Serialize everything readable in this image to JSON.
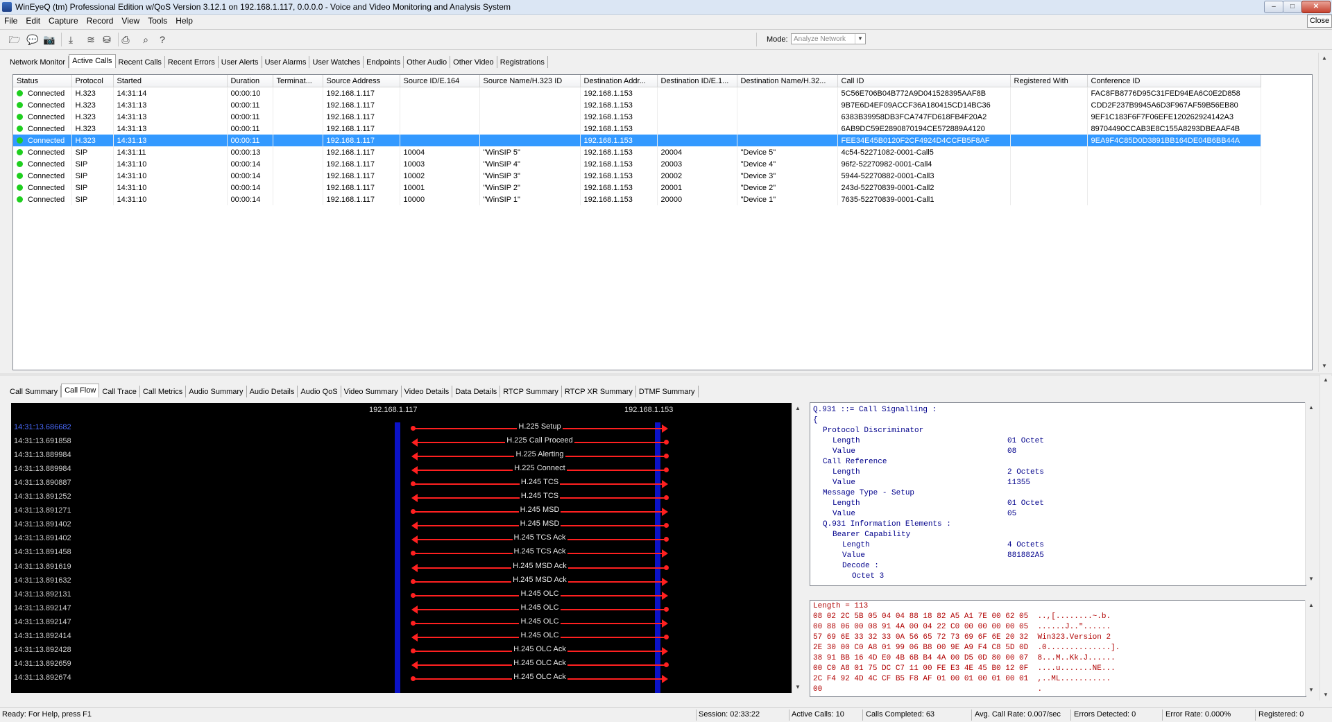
{
  "window": {
    "title": "WinEyeQ (tm) Professional Edition w/QoS Version 3.12.1 on 192.168.1.117, 0.0.0.0 - Voice and Video Monitoring and Analysis System",
    "close_label": "Close"
  },
  "menu": [
    "File",
    "Edit",
    "Capture",
    "Record",
    "View",
    "Tools",
    "Help"
  ],
  "toolbar": {
    "icons": [
      "open-icon",
      "chat-icon",
      "camera-icon",
      "download-icon",
      "layers-icon",
      "traffic-light-icon",
      "print-icon",
      "search-icon",
      "help-icon"
    ],
    "mode_label": "Mode:",
    "mode_value": "Analyze Network"
  },
  "top_tabs": [
    "Network Monitor",
    "Active Calls",
    "Recent Calls",
    "Recent Errors",
    "User Alerts",
    "User Alarms",
    "User Watches",
    "Endpoints",
    "Other Audio",
    "Other Video",
    "Registrations"
  ],
  "top_tab_active": 1,
  "calls": {
    "columns": [
      "Status",
      "Protocol",
      "Started",
      "Duration",
      "Terminat...",
      "Source Address",
      "Source ID/E.164",
      "Source Name/H.323 ID",
      "Destination Addr...",
      "Destination ID/E.1...",
      "Destination Name/H.32...",
      "Call ID",
      "Registered With",
      "Conference ID"
    ],
    "status_color": "#1fcf1f",
    "selected_row": 4,
    "rows": [
      [
        "Connected",
        "H.323",
        "14:31:14",
        "00:00:10",
        "",
        "192.168.1.117",
        "",
        "",
        "192.168.1.153",
        "",
        "",
        "5C56E706B04B772A9D041528395AAF8B",
        "",
        "FAC8FB8776D95C31FED94EA6C0E2D858"
      ],
      [
        "Connected",
        "H.323",
        "14:31:13",
        "00:00:11",
        "",
        "192.168.1.117",
        "",
        "",
        "192.168.1.153",
        "",
        "",
        "9B7E6D4EF09ACCF36A180415CD14BC36",
        "",
        "CDD2F237B9945A6D3F967AF59B56EB80"
      ],
      [
        "Connected",
        "H.323",
        "14:31:13",
        "00:00:11",
        "",
        "192.168.1.117",
        "",
        "",
        "192.168.1.153",
        "",
        "",
        "6383B39958DB3FCA747FD618FB4F20A2",
        "",
        "9EF1C183F6F7F06EFE120262924142A3"
      ],
      [
        "Connected",
        "H.323",
        "14:31:13",
        "00:00:11",
        "",
        "192.168.1.117",
        "",
        "",
        "192.168.1.153",
        "",
        "",
        "6AB9DC59E2890870194CE572889A4120",
        "",
        "89704490CCAB3E8C155A8293DBEAAF4B"
      ],
      [
        "Connected",
        "H.323",
        "14:31:13",
        "00:00:11",
        "",
        "192.168.1.117",
        "",
        "",
        "192.168.1.153",
        "",
        "",
        "FEE34E45B0120F2CF4924D4CCFB5F8AF",
        "",
        "9EA9F4C85D0D3891BB164DE04B6BB44A"
      ],
      [
        "Connected",
        "SIP",
        "14:31:11",
        "00:00:13",
        "",
        "192.168.1.117",
        "10004",
        "\"WinSIP 5\"",
        "192.168.1.153",
        "20004",
        "\"Device 5\"",
        "4c54-52271082-0001-Call5",
        "",
        ""
      ],
      [
        "Connected",
        "SIP",
        "14:31:10",
        "00:00:14",
        "",
        "192.168.1.117",
        "10003",
        "\"WinSIP 4\"",
        "192.168.1.153",
        "20003",
        "\"Device 4\"",
        "96f2-52270982-0001-Call4",
        "",
        ""
      ],
      [
        "Connected",
        "SIP",
        "14:31:10",
        "00:00:14",
        "",
        "192.168.1.117",
        "10002",
        "\"WinSIP 3\"",
        "192.168.1.153",
        "20002",
        "\"Device 3\"",
        "5944-52270882-0001-Call3",
        "",
        ""
      ],
      [
        "Connected",
        "SIP",
        "14:31:10",
        "00:00:14",
        "",
        "192.168.1.117",
        "10001",
        "\"WinSIP 2\"",
        "192.168.1.153",
        "20001",
        "\"Device 2\"",
        "243d-52270839-0001-Call2",
        "",
        ""
      ],
      [
        "Connected",
        "SIP",
        "14:31:10",
        "00:00:14",
        "",
        "192.168.1.117",
        "10000",
        "\"WinSIP 1\"",
        "192.168.1.153",
        "20000",
        "\"Device 1\"",
        "7635-52270839-0001-Call1",
        "",
        ""
      ]
    ]
  },
  "bottom_tabs": [
    "Call Summary",
    "Call Flow",
    "Call Trace",
    "Call Metrics",
    "Audio Summary",
    "Audio Details",
    "Audio QoS",
    "Video Summary",
    "Video Details",
    "Data Details",
    "RTCP Summary",
    "RTCP XR Summary",
    "DTMF Summary"
  ],
  "bottom_tab_active": 1,
  "call_flow": {
    "left_host": "192.168.1.117",
    "right_host": "192.168.1.153",
    "messages": [
      {
        "time": "14:31:13.686682",
        "label": "H.225 Setup",
        "dir": "right"
      },
      {
        "time": "14:31:13.691858",
        "label": "H.225 Call Proceed",
        "dir": "left"
      },
      {
        "time": "14:31:13.889984",
        "label": "H.225 Alerting",
        "dir": "left"
      },
      {
        "time": "14:31:13.889984",
        "label": "H.225 Connect",
        "dir": "left"
      },
      {
        "time": "14:31:13.890887",
        "label": "H.245 TCS",
        "dir": "right"
      },
      {
        "time": "14:31:13.891252",
        "label": "H.245 TCS",
        "dir": "left"
      },
      {
        "time": "14:31:13.891271",
        "label": "H.245 MSD",
        "dir": "right"
      },
      {
        "time": "14:31:13.891402",
        "label": "H.245 MSD",
        "dir": "left"
      },
      {
        "time": "14:31:13.891402",
        "label": "H.245 TCS Ack",
        "dir": "left"
      },
      {
        "time": "14:31:13.891458",
        "label": "H.245 TCS Ack",
        "dir": "right"
      },
      {
        "time": "14:31:13.891619",
        "label": "H.245 MSD Ack",
        "dir": "left"
      },
      {
        "time": "14:31:13.891632",
        "label": "H.245 MSD Ack",
        "dir": "right"
      },
      {
        "time": "14:31:13.892131",
        "label": "H.245 OLC",
        "dir": "right"
      },
      {
        "time": "14:31:13.892147",
        "label": "H.245 OLC",
        "dir": "left"
      },
      {
        "time": "14:31:13.892147",
        "label": "H.245 OLC",
        "dir": "right"
      },
      {
        "time": "14:31:13.892414",
        "label": "H.245 OLC",
        "dir": "left"
      },
      {
        "time": "14:31:13.892428",
        "label": "H.245 OLC Ack",
        "dir": "right"
      },
      {
        "time": "14:31:13.892659",
        "label": "H.245 OLC Ack",
        "dir": "left"
      },
      {
        "time": "14:31:13.892674",
        "label": "H.245 OLC Ack",
        "dir": "right"
      }
    ]
  },
  "decode": {
    "lines": [
      {
        "indent": 0,
        "name": "Q.931 ::= Call Signalling :",
        "value": ""
      },
      {
        "indent": 0,
        "name": "{",
        "value": ""
      },
      {
        "indent": 1,
        "name": "Protocol Discriminator",
        "value": ""
      },
      {
        "indent": 2,
        "name": "Length",
        "value": "01 Octet"
      },
      {
        "indent": 2,
        "name": "Value",
        "value": "08"
      },
      {
        "indent": 1,
        "name": "Call Reference",
        "value": ""
      },
      {
        "indent": 2,
        "name": "Length",
        "value": "2 Octets"
      },
      {
        "indent": 2,
        "name": "Value",
        "value": "11355"
      },
      {
        "indent": 1,
        "name": "Message Type - Setup",
        "value": ""
      },
      {
        "indent": 2,
        "name": "Length",
        "value": "01 Octet"
      },
      {
        "indent": 2,
        "name": "Value",
        "value": "05"
      },
      {
        "indent": 1,
        "name": "Q.931 Information Elements :",
        "value": ""
      },
      {
        "indent": 2,
        "name": "Bearer Capability",
        "value": ""
      },
      {
        "indent": 3,
        "name": "Length",
        "value": "4 Octets"
      },
      {
        "indent": 3,
        "name": "Value",
        "value": "881882A5"
      },
      {
        "indent": 3,
        "name": "Decode :",
        "value": ""
      },
      {
        "indent": 4,
        "name": "Octet 3",
        "value": ""
      }
    ]
  },
  "hex": {
    "header": "Length = 113",
    "lines": [
      "08 02 2C 5B 05 04 04 88 18 82 A5 A1 7E 00 62 05  ..,[........~.b.",
      "00 88 06 00 08 91 4A 00 04 22 C0 00 00 00 00 05  ......J..\"......",
      "57 69 6E 33 32 33 0A 56 65 72 73 69 6F 6E 20 32  Win323.Version 2",
      "2E 30 00 C0 A8 01 99 06 B8 00 9E A9 F4 C8 5D 0D  .0..............].",
      "38 91 BB 16 4D E0 4B 6B B4 4A 00 D5 0D 80 00 07  8...M..Kk.J......",
      "00 C0 A8 01 75 DC C7 11 00 FE E3 4E 45 B0 12 0F  ....u.......NE...",
      "2C F4 92 4D 4C CF B5 F8 AF 01 00 01 00 01 00 01  ,..ML...........",
      "00                                               ."
    ]
  },
  "status": {
    "help": "Ready: For Help, press F1",
    "session": "Session: 02:33:22",
    "active_calls": "Active Calls: 10",
    "calls_completed": "Calls Completed: 63",
    "avg_call_rate": "Avg. Call Rate: 0.007/sec",
    "errors_detected": "Errors Detected: 0",
    "error_rate": "Error Rate: 0.000%",
    "registered": "Registered: 0"
  }
}
